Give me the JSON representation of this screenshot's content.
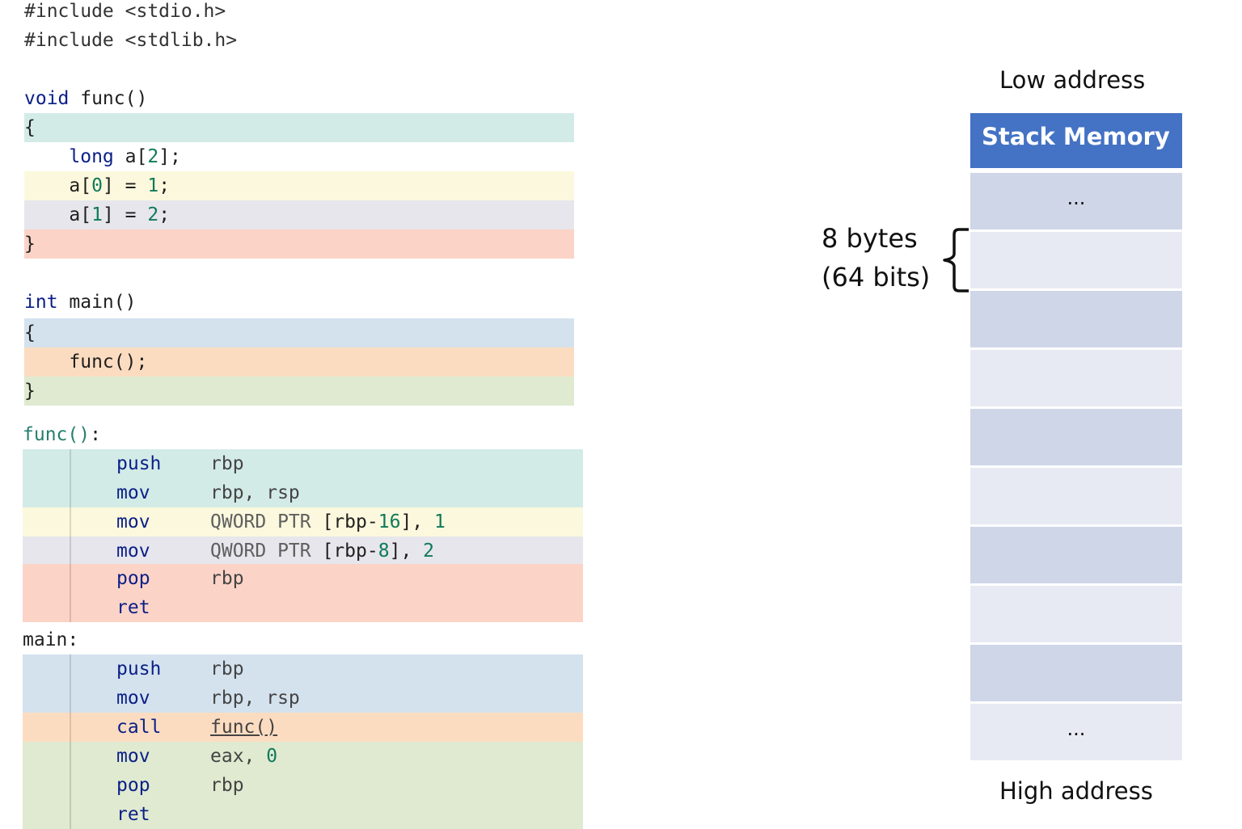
{
  "c_code": {
    "includes": [
      "#include <stdio.h>",
      "#include <stdlib.h>"
    ],
    "func_signature": {
      "type": "void",
      "name": " func()"
    },
    "open_brace": "{",
    "close_brace": "}",
    "decl": {
      "type": "long",
      "rest_before": " a[",
      "size": "2",
      "rest_after": "];"
    },
    "assign0": {
      "pre": "a[",
      "index": "0",
      "mid": "] = ",
      "value": "1",
      "end": ";"
    },
    "assign1": {
      "pre": "a[",
      "index": "1",
      "mid": "] = ",
      "value": "2",
      "end": ";"
    },
    "main_signature": {
      "type": "int",
      "name": " main()"
    },
    "call": "func();"
  },
  "assembly": {
    "func_label": {
      "name": "func()",
      "colon": ":"
    },
    "func_lines": [
      {
        "op": "push",
        "args": "rbp"
      },
      {
        "op": "mov",
        "args": "rbp, rsp"
      },
      {
        "op": "mov",
        "args_pre": "QWORD PTR ",
        "args_ref": "[rbp-",
        "args_off": "16",
        "args_close": "], ",
        "args_val": "1"
      },
      {
        "op": "mov",
        "args_pre": "QWORD PTR ",
        "args_ref": "[rbp-",
        "args_off": "8",
        "args_close": "], ",
        "args_val": "2"
      },
      {
        "op": "pop",
        "args": "rbp"
      },
      {
        "op": "ret",
        "args": ""
      }
    ],
    "main_label": "main:",
    "main_lines": [
      {
        "op": "push",
        "args": "rbp"
      },
      {
        "op": "mov",
        "args": "rbp, rsp"
      },
      {
        "op": "call",
        "args": "func()"
      },
      {
        "op": "mov",
        "args_pre": "eax, ",
        "args_val": "0"
      },
      {
        "op": "pop",
        "args": "rbp"
      },
      {
        "op": "ret",
        "args": ""
      }
    ]
  },
  "stack": {
    "low_address": "Low address",
    "high_address": "High address",
    "header": "Stack Memory",
    "size_label_line1": "8 bytes",
    "size_label_line2": "(64 bits)",
    "cells": [
      "...",
      "",
      "",
      "",
      "",
      "",
      "",
      "",
      "",
      "..."
    ]
  },
  "colors": {
    "teal": "#d3ebe6",
    "yellow": "#fcf8dd",
    "gray": "#e6e6ec",
    "red": "#fcd3c7",
    "blue": "#d4e2ee",
    "orange": "#fcdcc1",
    "green": "#dfead0",
    "stack_header": "#4472c4",
    "stack_dark": "#cfd6e8",
    "stack_light": "#e8eaf3"
  }
}
